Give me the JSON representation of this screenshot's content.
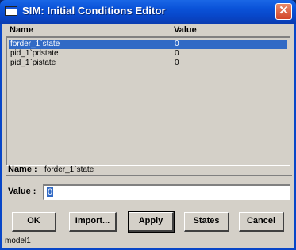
{
  "window": {
    "title": "SIM: Initial Conditions Editor",
    "close_glyph": "✕"
  },
  "list": {
    "headers": {
      "name": "Name",
      "value": "Value"
    },
    "rows": [
      {
        "name": "forder_1`state",
        "value": "0"
      },
      {
        "name": "pid_1`pdstate",
        "value": "0"
      },
      {
        "name": "pid_1`pistate",
        "value": "0"
      }
    ]
  },
  "detail": {
    "name_label": "Name :",
    "name_value": "forder_1`state",
    "value_label": "Value :",
    "value_input": "0"
  },
  "buttons": {
    "ok": "OK",
    "import": "Import...",
    "apply": "Apply",
    "states": "States",
    "cancel": "Cancel"
  },
  "status": {
    "text": "model1"
  },
  "colors": {
    "selection": "#316ac5",
    "titlebar": "#0a53d9",
    "face": "#d4d0c8"
  }
}
